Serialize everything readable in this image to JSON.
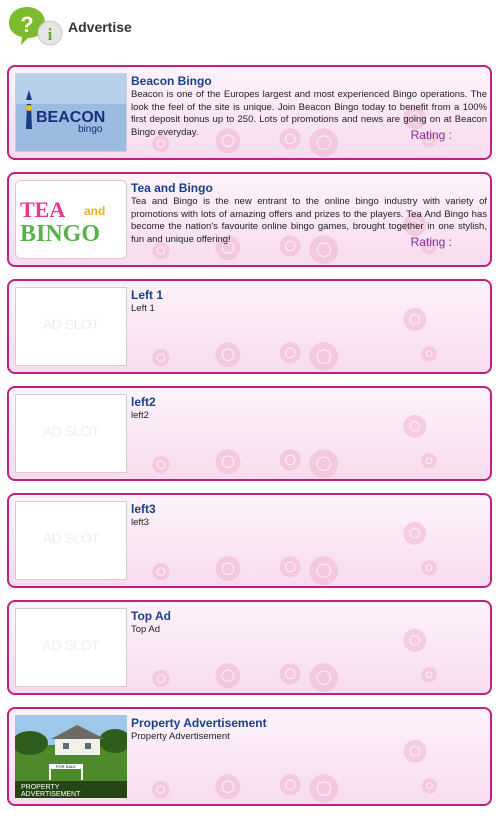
{
  "header": {
    "title": "Advertise",
    "icon": "question-info-bubbles-icon"
  },
  "ads": [
    {
      "title": "Beacon Bingo",
      "description": "Beacon is one of the Europes largest and most experienced Bingo operations. The look the feel of the site is unique. Join Beacon Bingo today to benefit from a 100% first deposit bonus up to 250. Lots of promotions and news are going on at Beacon Bingo everyday.",
      "rating_label": "Rating :",
      "logo": "beacon-bingo-logo",
      "logo_text": "BEACON",
      "logo_subtext": "bingo"
    },
    {
      "title": "Tea and Bingo",
      "description": "Tea and Bingo is the new entrant to the online bingo industry with variety of promotions with lots of amazing offers and prizes to the players. Tea And Bingo has become the nation's favourite online bingo games, brought together in one stylish, fun and unique offering!",
      "rating_label": "Rating :",
      "logo": "tea-and-bingo-logo",
      "logo_text_1": "TEA",
      "logo_text_and": "and",
      "logo_text_2": "BINGO"
    },
    {
      "title": "Left 1",
      "description": "Left 1",
      "slot_text": "AD SLOT"
    },
    {
      "title": "left2",
      "description": "left2",
      "slot_text": "AD SLOT"
    },
    {
      "title": "left3",
      "description": "left3",
      "slot_text": "AD SLOT"
    },
    {
      "title": "Top Ad",
      "description": "Top Ad",
      "slot_text": "AD SLOT"
    },
    {
      "title": "Property Advertisement",
      "description": "Property Advertisement",
      "image": "house-for-sale-photo",
      "sign_text": "FOR SALE",
      "caption_1": "PROPERTY",
      "caption_2": "ADVERTISEMENT"
    }
  ]
}
